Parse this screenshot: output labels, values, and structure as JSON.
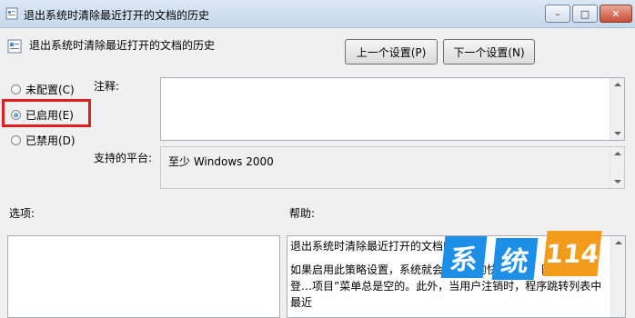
{
  "window": {
    "title": "退出系统时清除最近打开的文档的历史",
    "minimize_label": "–",
    "maximize_label": "□",
    "close_label": "✕"
  },
  "header": {
    "policy_name": "退出系统时清除最近打开的文档的历史",
    "prev_setting": "上一个设置(P)",
    "next_setting": "下一个设置(N)"
  },
  "state_options": [
    {
      "label": "未配置(C)",
      "checked": false
    },
    {
      "label": "已启用(E)",
      "checked": true
    },
    {
      "label": "已禁用(D)",
      "checked": false
    }
  ],
  "comment": {
    "label": "注释:",
    "value": ""
  },
  "supported": {
    "label": "支持的平台:",
    "value": "至少 Windows 2000"
  },
  "options": {
    "label": "选项:"
  },
  "help": {
    "label": "帮助:",
    "paragraphs": [
      "退出系统时清除最近打开的文档的历史。",
      "如果启用此策略设置，系统就会…文件的快捷方式。因此，用户登…项目”菜单总是空的。此外，当用户注销时，程序跳转列表中最近"
    ]
  },
  "watermark": {
    "text1": "系",
    "text2": "统",
    "text3": "114"
  },
  "colors": {
    "highlight": "#e02020",
    "watermark_blue": "#1e8fe6",
    "watermark_orange": "#f29b1d"
  }
}
